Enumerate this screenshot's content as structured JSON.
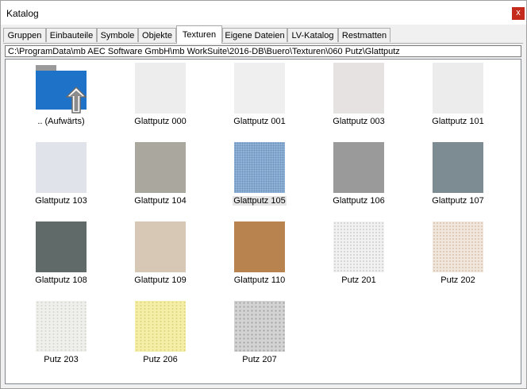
{
  "window": {
    "title": "Katalog",
    "close_label": "x"
  },
  "tabs": [
    "Gruppen",
    "Einbauteile",
    "Symbole",
    "Objekte",
    "Texturen",
    "Eigene Dateien",
    "LV-Katalog",
    "Restmatten"
  ],
  "active_tab": "Texturen",
  "path": "C:\\ProgramData\\mb AEC Software GmbH\\mb WorkSuite\\2016-DB\\Buero\\Texturen\\060 Putz\\Glattputz",
  "items": [
    {
      "label": ".. (Aufwärts)",
      "icon": "folder-up-icon"
    },
    {
      "label": "Glattputz 000",
      "color": "#ededed"
    },
    {
      "label": "Glattputz 001",
      "color": "#efefef"
    },
    {
      "label": "Glattputz 003",
      "color": "#e6e2e2"
    },
    {
      "label": "Glattputz 101",
      "color": "#ececec"
    },
    {
      "label": "Glattputz 103",
      "color": "#e0e4ea"
    },
    {
      "label": "Glattputz 104",
      "color": "#aaa79e"
    },
    {
      "label": "Glattputz 105",
      "color": "#8fb2d6",
      "selected": true
    },
    {
      "label": "Glattputz 106",
      "color": "#9a9a9a"
    },
    {
      "label": "Glattputz 107",
      "color": "#7d8c93"
    },
    {
      "label": "Glattputz 108",
      "color": "#5f6a69"
    },
    {
      "label": "Glattputz 109",
      "color": "#d7c8b6"
    },
    {
      "label": "Glattputz 110",
      "color": "#b9834f"
    },
    {
      "label": "Putz 201",
      "color": "#f1f1f1"
    },
    {
      "label": "Putz 202",
      "color": "#f1e6dc"
    },
    {
      "label": "Putz 203",
      "color": "#efefec"
    },
    {
      "label": "Putz 206",
      "color": "#f4eea6"
    },
    {
      "label": "Putz 207",
      "color": "#d3d3d3"
    }
  ],
  "colors": {
    "folder_blue": "#1e73c8",
    "close_red": "#c42b1c",
    "selection_bg": "#e5e5e5"
  }
}
